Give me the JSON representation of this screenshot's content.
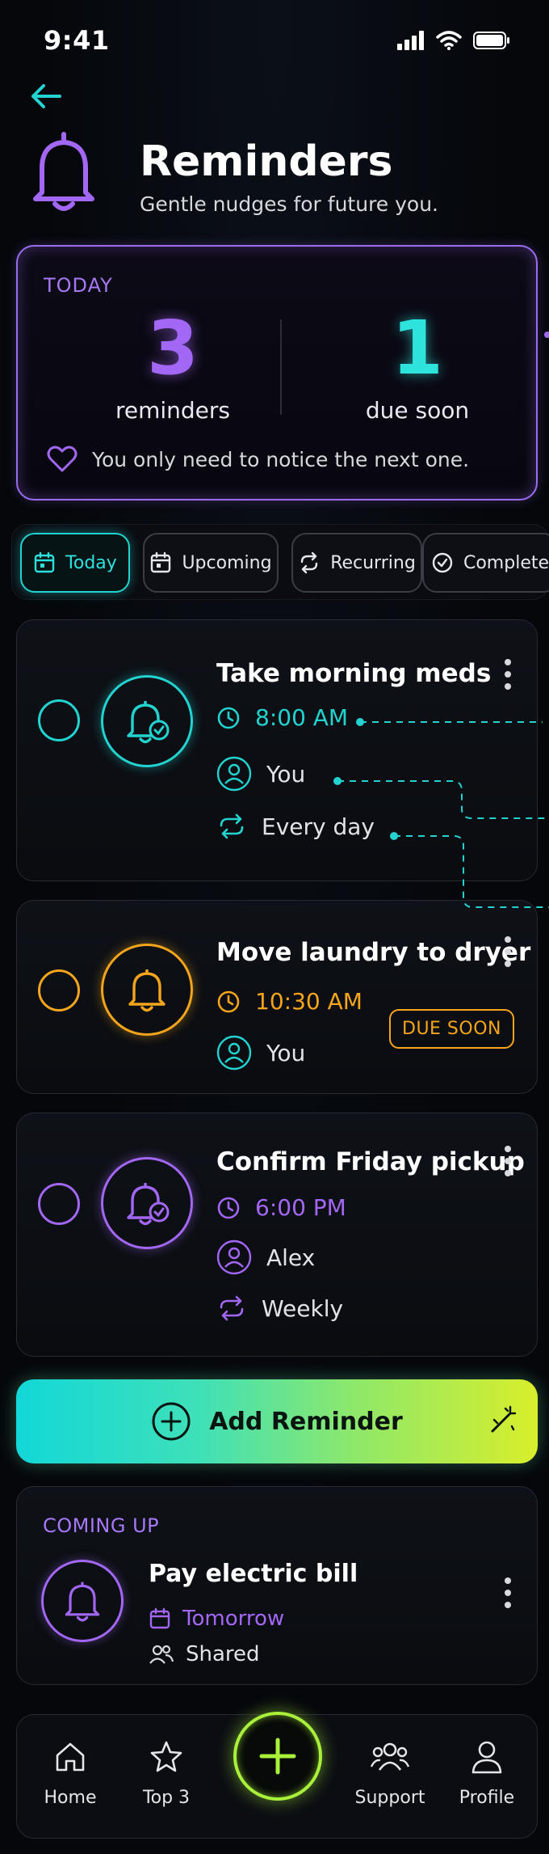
{
  "status": {
    "time": "9:41"
  },
  "header": {
    "title": "Reminders",
    "subtitle": "Gentle nudges for future you."
  },
  "today": {
    "label": "TODAY",
    "reminders_count": "3",
    "reminders_label": "reminders",
    "due_count": "1",
    "due_label": "due soon",
    "note": "You only need to notice the next one."
  },
  "tabs": [
    {
      "label": "Today",
      "active": true
    },
    {
      "label": "Upcoming",
      "active": false
    },
    {
      "label": "Recurring",
      "active": false
    },
    {
      "label": "Complete",
      "active": false
    }
  ],
  "reminders": [
    {
      "title": "Take morning meds",
      "time": "8:00 AM",
      "person": "You",
      "repeat": "Every day",
      "color": "#22d3d0"
    },
    {
      "title": "Move laundry to dryer",
      "time": "10:30 AM",
      "person": "You",
      "badge": "DUE SOON",
      "color": "#f4a51c"
    },
    {
      "title": "Confirm Friday pickup",
      "time": "6:00 PM",
      "person": "Alex",
      "repeat": "Weekly",
      "color": "#a367f5"
    }
  ],
  "add_button": {
    "label": "Add Reminder"
  },
  "coming_up": {
    "label": "COMING UP",
    "title": "Pay electric bill",
    "when": "Tomorrow",
    "shared": "Shared"
  },
  "nav": {
    "home": "Home",
    "top3": "Top 3",
    "support": "Support",
    "profile": "Profile"
  },
  "colors": {
    "accent_cyan": "#22d3d0",
    "accent_purple": "#a367f5",
    "accent_amber": "#f4a51c",
    "accent_lime": "#a8f03a"
  }
}
